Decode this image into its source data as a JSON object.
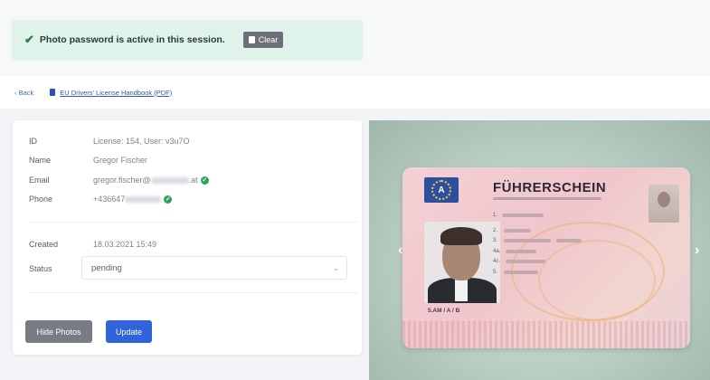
{
  "alert": {
    "message": "Photo password is active in this session.",
    "clear_label": "Clear"
  },
  "nav": {
    "back_label": "‹ Back",
    "handbook_label": "EU Drivers' License Handbook (PDF)"
  },
  "details": {
    "id": {
      "label": "ID",
      "value": "License: 154, User: v3u7O"
    },
    "name": {
      "label": "Name",
      "value": "Gregor Fischer"
    },
    "email": {
      "label": "Email",
      "value_visible": "gregor.fischer@",
      "value_end": ".at"
    },
    "phone": {
      "label": "Phone",
      "value_visible": "+436647"
    },
    "created": {
      "label": "Created",
      "value": "18.03.2021 15:49"
    },
    "status": {
      "label": "Status",
      "value": "pending"
    }
  },
  "buttons": {
    "hide_photos": "Hide Photos",
    "update": "Update"
  },
  "license_card": {
    "title": "FÜHRERSCHEIN",
    "country_code": "A",
    "category_text": "5.AM / A / B",
    "field_numbers": [
      "1.",
      "2.",
      "3.",
      "4a.",
      "4c.",
      "5."
    ]
  },
  "colors": {
    "alert_bg": "#dff3ea",
    "primary": "#2f64da",
    "secondary": "#787c84",
    "verified": "#2aa45c"
  }
}
